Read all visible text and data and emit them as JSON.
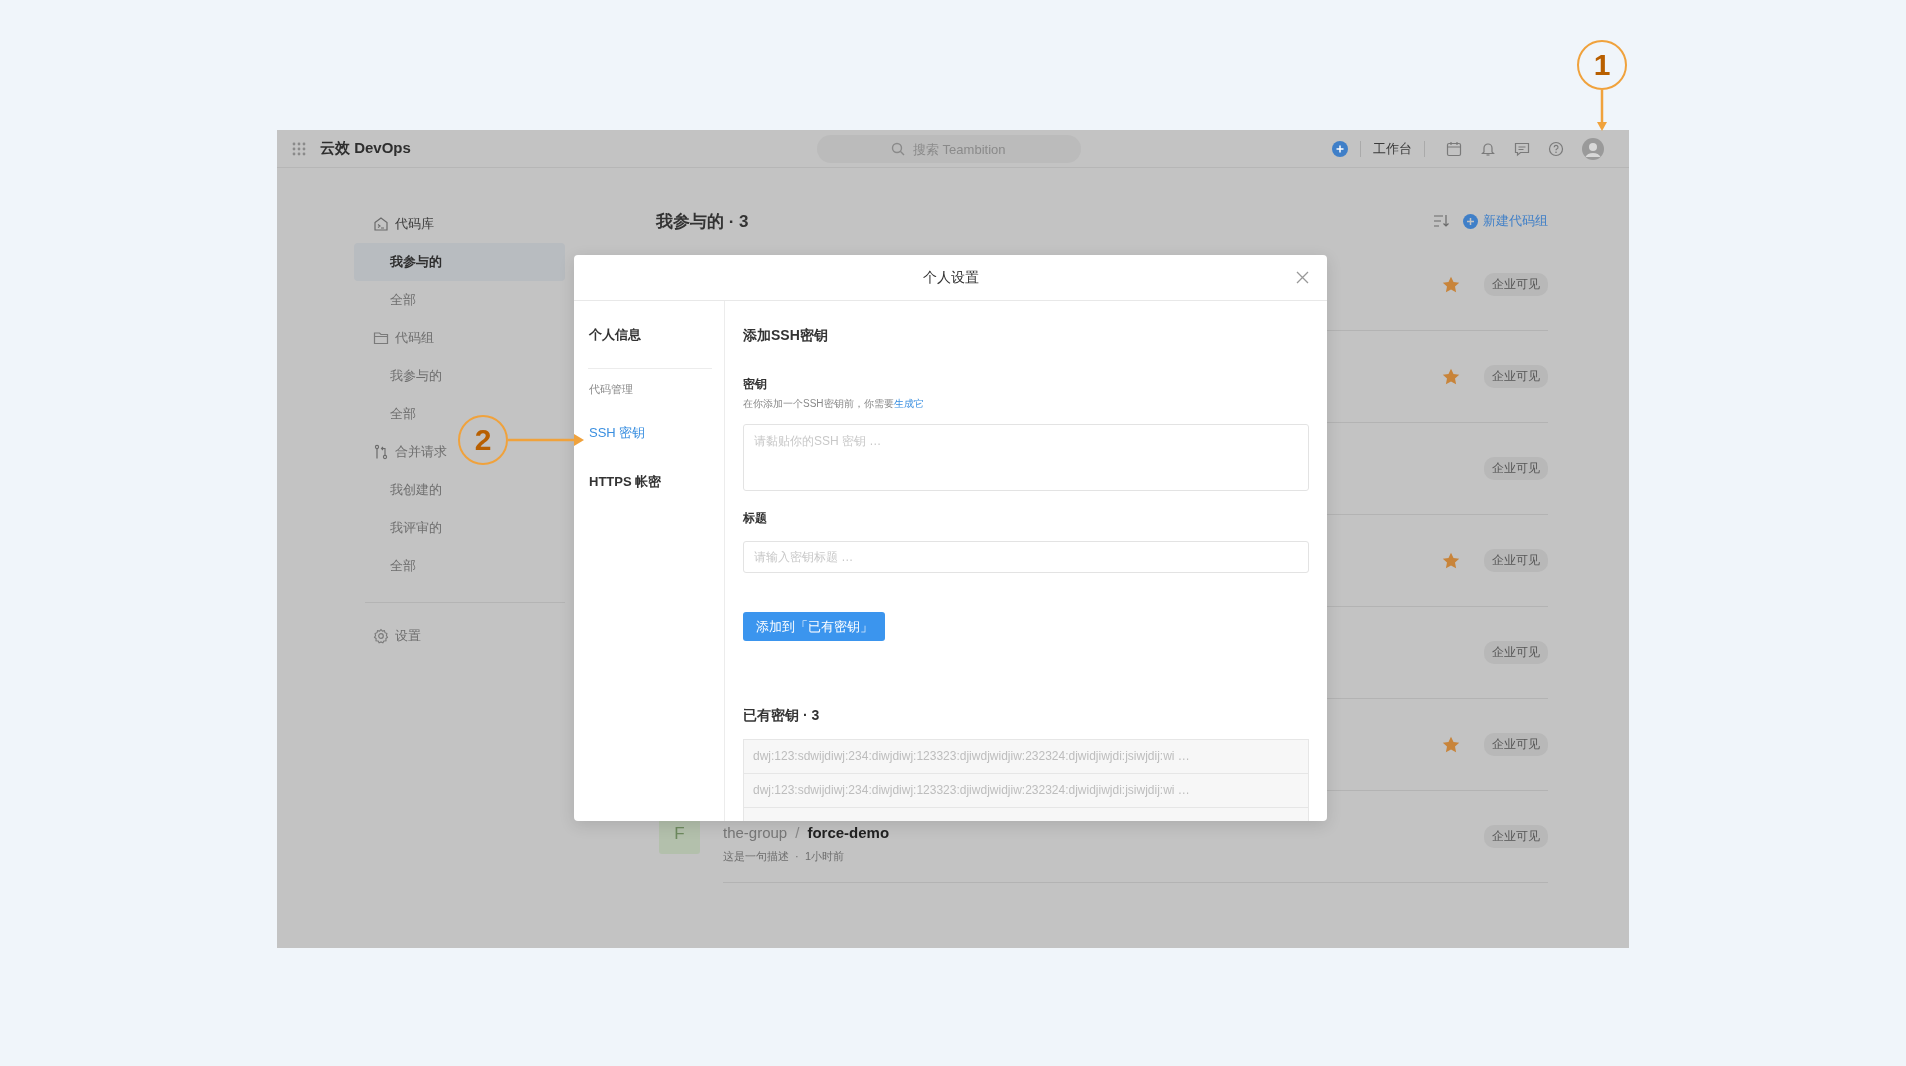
{
  "topbar": {
    "title": "云效 DevOps",
    "search": {
      "placeholder": "搜索 Teambition"
    },
    "workbench": "工作台"
  },
  "sidebar": {
    "groups": [
      {
        "kind": "repo",
        "label": "代码库",
        "items": [
          {
            "label": "我参与的",
            "selected": true
          },
          {
            "label": "全部",
            "selected": false
          }
        ]
      },
      {
        "kind": "folder",
        "label": "代码组",
        "items": [
          {
            "label": "我参与的",
            "selected": false
          },
          {
            "label": "全部",
            "selected": false
          }
        ]
      },
      {
        "kind": "merge",
        "label": "合并请求",
        "items": [
          {
            "label": "我创建的",
            "selected": false
          },
          {
            "label": "我评审的",
            "selected": false
          },
          {
            "label": "全部",
            "selected": false
          }
        ]
      }
    ],
    "settings": "设置"
  },
  "main": {
    "title": "我参与的 · 3",
    "new_button": "新建代码组",
    "repos": [
      {
        "starred": true,
        "visibility": "企业可见"
      },
      {
        "starred": true,
        "visibility": "企业可见"
      },
      {
        "starred": false,
        "visibility": "企业可见"
      },
      {
        "starred": true,
        "visibility": "企业可见"
      },
      {
        "starred": false,
        "visibility": "企业可见"
      },
      {
        "starred": true,
        "visibility": "企业可见"
      },
      {
        "avatar": "F",
        "group": "the-group",
        "separator": "/",
        "name": "force-demo",
        "meta": "这是一句描述  ·  1小时前",
        "starred": false,
        "visibility": "企业可见"
      }
    ]
  },
  "modal": {
    "title": "个人设置",
    "nav": [
      {
        "kind": "item",
        "label": "个人信息",
        "selected": false
      },
      {
        "kind": "section",
        "label": "代码管理"
      },
      {
        "kind": "item",
        "label": "SSH 密钥",
        "selected": true
      },
      {
        "kind": "item",
        "label": "HTTPS 帐密",
        "selected": false
      }
    ],
    "heading": "添加SSH密钥",
    "key_label": "密钥",
    "hint": "在你添加一个SSH密钥前，你需要",
    "hint_link": "生成它",
    "key_placeholder": "请黏贴你的SSH 密钥 …",
    "title_label": "标题",
    "title_placeholder": "请输入密钥标题 …",
    "add_button": "添加到「已有密钥」",
    "keys_heading": "已有密钥 · 3",
    "keys": [
      "dwj:123:sdwijdiwj:234:diwjdiwj:123323:djiwdjwidjiw:232324:djwidjiwjdi:jsiwjdij:wi …",
      "dwj:123:sdwijdiwj:234:diwjdiwj:123323:djiwdjwidjiw:232324:djwidjiwjdi:jsiwjdij:wi …"
    ]
  },
  "callouts": [
    {
      "number": "1"
    },
    {
      "number": "2"
    }
  ]
}
